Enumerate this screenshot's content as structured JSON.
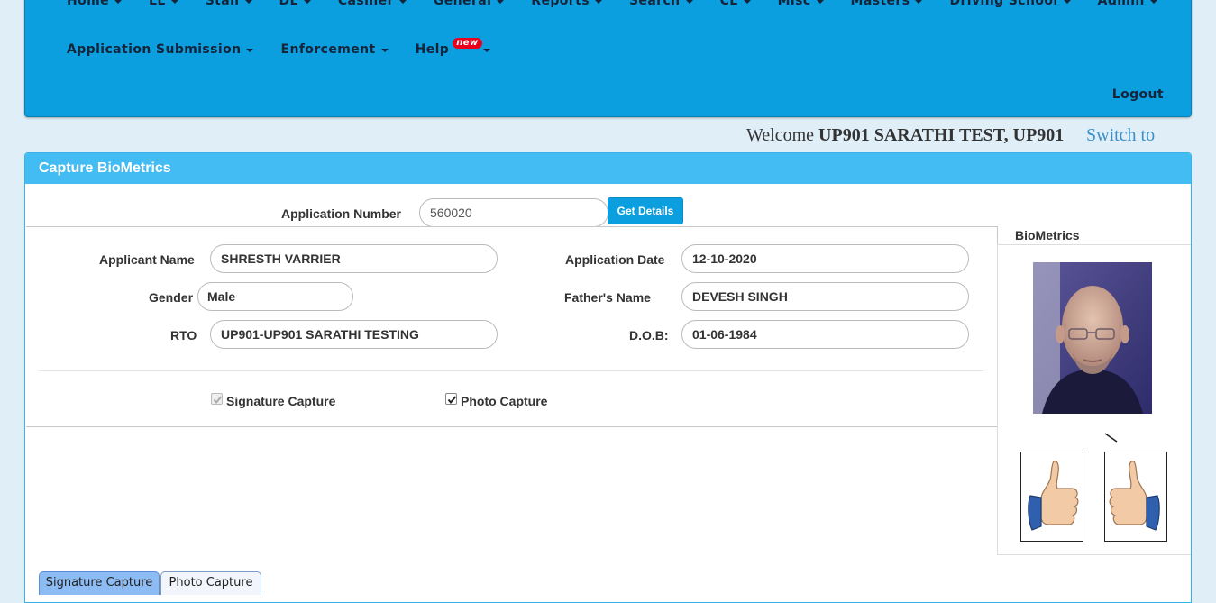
{
  "nav": {
    "row1": [
      "Home",
      "LL",
      "Stall",
      "DL",
      "Cashier",
      "General",
      "Reports",
      "Search",
      "CL",
      "Misc",
      "Masters",
      "Driving School",
      "Admin"
    ],
    "row2": [
      "Application Submission",
      "Enforcement",
      "Help"
    ],
    "help_badge": "new",
    "logout": "Logout"
  },
  "welcome": {
    "prefix": "Welcome",
    "user": "UP901 SARATHI TEST, UP901",
    "switch_to": "Switch to"
  },
  "panel": {
    "title": "Capture BioMetrics",
    "application_number_label": "Application Number",
    "application_number_value": "560020",
    "get_details_button": "Get Details",
    "applicant_name_label": "Applicant Name",
    "applicant_name_value": "SHRESTH VARRIER",
    "application_date_label": "Application Date",
    "application_date_value": "12-10-2020",
    "gender_label": "Gender",
    "gender_value": "Male",
    "fathers_name_label": "Father's Name",
    "fathers_name_value": "DEVESH SINGH",
    "rto_label": "RTO",
    "rto_value": "UP901-UP901 SARATHI TESTING",
    "dob_label": "D.O.B:",
    "dob_value": "01-06-1984",
    "signature_capture_label": "Signature Capture",
    "signature_capture_checked": true,
    "photo_capture_label": "Photo Capture",
    "photo_capture_checked": true
  },
  "biometrics": {
    "title": "BioMetrics",
    "photo_icon": "person-photo",
    "left_thumb_icon": "thumbs-up-icon",
    "right_thumb_icon": "thumbs-up-icon"
  },
  "tabs": [
    "Signature Capture",
    "Photo Capture"
  ],
  "colors": {
    "nav_bg": "#0b9fdf",
    "panel_header": "#42bcf3",
    "badge": "#e8001c",
    "link": "#3a8fc8"
  }
}
